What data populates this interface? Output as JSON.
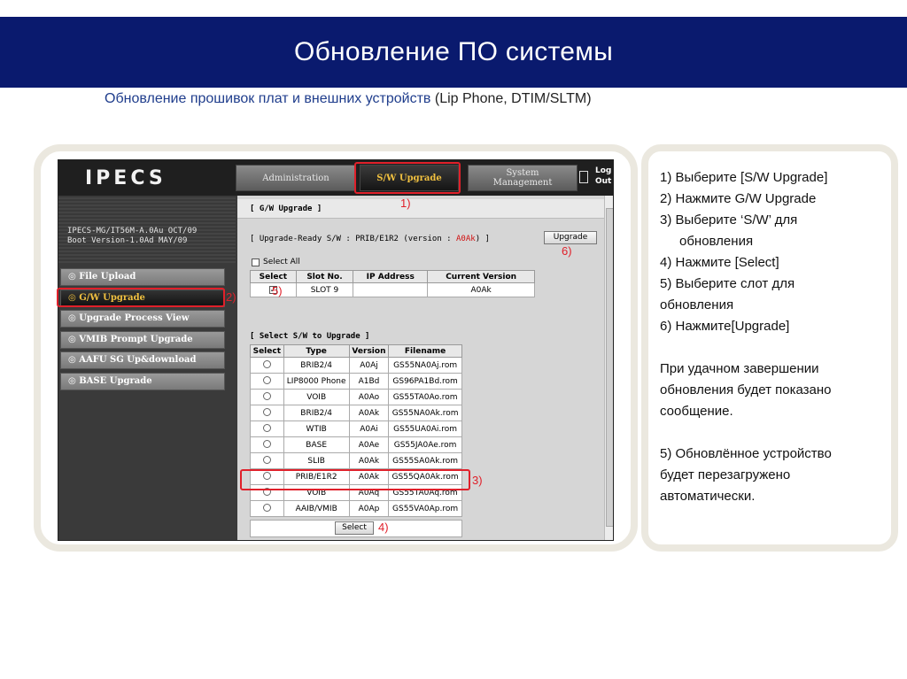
{
  "slide": {
    "title": "Обновление ПО системы",
    "subtitle_main": "Обновление прошивок плат и внешних устройств ",
    "subtitle_paren": "(Lip Phone, DTIM/SLTM)"
  },
  "instructions": {
    "step1": "1) Выберите  [S/W Upgrade]",
    "step2": "2) Нажмите G/W Upgrade",
    "step3a": "3) Выберите ‘S/W’ для",
    "step3b": "обновления",
    "step4": "4) Нажмите [Select]",
    "step5a": "5) Выберите слот для",
    "step5b": "обновления",
    "step6": "6) Нажмите[Upgrade]",
    "success_a": "При удачном завершении",
    "success_b": "обновления будет показано",
    "success_c": "сообщение.",
    "reboot_a": "5) Обновлённое устройство",
    "reboot_b": "будет перезагружено",
    "reboot_c": "автоматически."
  },
  "app": {
    "logo": "IPECS",
    "tabs": {
      "administration": "Administration",
      "sw_upgrade": "S/W Upgrade",
      "system_management_1": "System",
      "system_management_2": "Management",
      "logout_1": "Log",
      "logout_2": "Out"
    },
    "system_info_1": "IPECS-MG/IT56M-A.0Au OCT/09",
    "system_info_2": "Boot Version-1.0Ad MAY/09",
    "menu": {
      "file_upload": "◎ File Upload",
      "gw_upgrade": "◎ G/W Upgrade",
      "upgrade_process": "◎ Upgrade Process View",
      "vmib_prompt": "◎ VMIB Prompt Upgrade",
      "aafu_sg": "◎ AAFU SG Up&download",
      "base_upgrade": "◎ BASE Upgrade"
    },
    "content": {
      "section_title": "[ G/W Upgrade ]",
      "ready_prefix": "[ Upgrade-Ready S/W : PRIB/E1R2 (version : ",
      "ready_version": "A0Ak",
      "ready_suffix": ") ]",
      "upgrade_button": "Upgrade",
      "select_all": "Select All",
      "slot_table": {
        "headers": [
          "Select",
          "Slot No.",
          "IP Address",
          "Current Version"
        ],
        "row": {
          "checked": "✓",
          "slot": "SLOT 9",
          "ip": "",
          "version": "A0Ak"
        }
      },
      "sw_section_title": "[ Select S/W to Upgrade ]",
      "sw_table": {
        "headers": [
          "Select",
          "Type",
          "Version",
          "Filename"
        ],
        "rows": [
          {
            "type": "BRIB2/4",
            "version": "A0Aj",
            "filename": "GS55NA0Aj.rom"
          },
          {
            "type": "LIP8000 Phone",
            "version": "A1Bd",
            "filename": "GS96PA1Bd.rom"
          },
          {
            "type": "VOIB",
            "version": "A0Ao",
            "filename": "GS55TA0Ao.rom"
          },
          {
            "type": "BRIB2/4",
            "version": "A0Ak",
            "filename": "GS55NA0Ak.rom"
          },
          {
            "type": "WTIB",
            "version": "A0Ai",
            "filename": "GS55UA0Ai.rom"
          },
          {
            "type": "BASE",
            "version": "A0Ae",
            "filename": "GS55JA0Ae.rom"
          },
          {
            "type": "SLIB",
            "version": "A0Ak",
            "filename": "GS55SA0Ak.rom"
          },
          {
            "type": "PRIB/E1R2",
            "version": "A0Ak",
            "filename": "GS55QA0Ak.rom"
          },
          {
            "type": "VOIB",
            "version": "A0Aq",
            "filename": "GS55TA0Aq.rom"
          },
          {
            "type": "AAIB/VMIB",
            "version": "A0Ap",
            "filename": "GS55VA0Ap.rom"
          }
        ]
      },
      "select_button": "Select"
    }
  },
  "annotations": {
    "a1": "1)",
    "a2": "2)",
    "a3": "3)",
    "a4": "4)",
    "a5": "5)",
    "a6": "6)"
  },
  "colors": {
    "header_bg": "#0a1a6e",
    "highlight": "#e0202a",
    "panel_border": "#ebe8df"
  }
}
